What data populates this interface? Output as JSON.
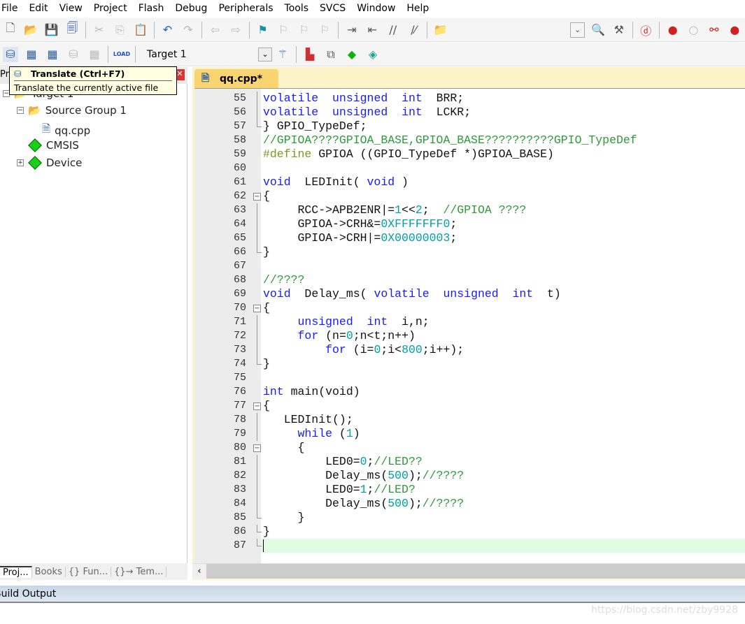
{
  "menu": [
    "File",
    "Edit",
    "View",
    "Project",
    "Flash",
    "Debug",
    "Peripherals",
    "Tools",
    "SVCS",
    "Window",
    "Help"
  ],
  "toolbar2": {
    "target": "Target 1",
    "load_label": "LOAD"
  },
  "tooltip": {
    "title": "Translate (Ctrl+F7)",
    "description": "Translate the currently active file"
  },
  "project": {
    "header": "Proj",
    "tree": [
      {
        "label": "Target 1",
        "level": 0,
        "toggle": "-",
        "icon": "folder-target-icon"
      },
      {
        "label": "Source Group 1",
        "level": 1,
        "toggle": "-",
        "icon": "folder-open-icon"
      },
      {
        "label": "qq.cpp",
        "level": 2,
        "toggle": "",
        "icon": "cpp-file-icon"
      },
      {
        "label": "CMSIS",
        "level": 1,
        "toggle": "",
        "icon": "component-diamond-icon"
      },
      {
        "label": "Device",
        "level": 1,
        "toggle": "+",
        "icon": "component-diamond-icon"
      }
    ],
    "tabs": [
      "Proj...",
      "Books",
      "{} Fun...",
      "{}→ Tem..."
    ]
  },
  "editor": {
    "tab": "qq.cpp*",
    "current_line": 87,
    "lines": [
      {
        "n": 55,
        "f": "v",
        "t": [
          [
            "kw",
            "volatile"
          ],
          [
            "tx",
            "  "
          ],
          [
            "kw",
            "unsigned"
          ],
          [
            "tx",
            "  "
          ],
          [
            "kw",
            "int"
          ],
          [
            "tx",
            "  BRR;"
          ]
        ]
      },
      {
        "n": 56,
        "f": "v",
        "t": [
          [
            "kw",
            "volatile"
          ],
          [
            "tx",
            "  "
          ],
          [
            "kw",
            "unsigned"
          ],
          [
            "tx",
            "  "
          ],
          [
            "kw",
            "int"
          ],
          [
            "tx",
            "  LCKR;"
          ]
        ]
      },
      {
        "n": 57,
        "f": "e",
        "t": [
          [
            "tx",
            "} GPIO_TypeDef;"
          ]
        ]
      },
      {
        "n": 58,
        "f": "",
        "t": [
          [
            "cm",
            "//GPIOA????GPIOA_BASE,GPIOA_BASE??????????GPIO_TypeDef"
          ]
        ]
      },
      {
        "n": 59,
        "f": "",
        "t": [
          [
            "pp",
            "#define"
          ],
          [
            "tx",
            " GPIOA ((GPIO_TypeDef *)GPIOA_BASE)"
          ]
        ]
      },
      {
        "n": 60,
        "f": "",
        "t": []
      },
      {
        "n": 61,
        "f": "",
        "t": [
          [
            "kw",
            "void"
          ],
          [
            "tx",
            "  LEDInit( "
          ],
          [
            "kw",
            "void"
          ],
          [
            "tx",
            " )"
          ]
        ]
      },
      {
        "n": 62,
        "f": "b",
        "t": [
          [
            "tx",
            "{"
          ]
        ]
      },
      {
        "n": 63,
        "f": "v",
        "t": [
          [
            "tx",
            "     RCC->APB2ENR|="
          ],
          [
            "num",
            "1"
          ],
          [
            "tx",
            "<<"
          ],
          [
            "num",
            "2"
          ],
          [
            "tx",
            ";  "
          ],
          [
            "cm",
            "//GPIOA ????"
          ]
        ]
      },
      {
        "n": 64,
        "f": "v",
        "t": [
          [
            "tx",
            "     GPIOA->CRH&="
          ],
          [
            "num",
            "0XFFFFFFF0"
          ],
          [
            "tx",
            ";"
          ]
        ]
      },
      {
        "n": 65,
        "f": "v",
        "t": [
          [
            "tx",
            "     GPIOA->CRH|="
          ],
          [
            "num",
            "0X00000003"
          ],
          [
            "tx",
            ";"
          ]
        ]
      },
      {
        "n": 66,
        "f": "e",
        "t": [
          [
            "tx",
            "}"
          ]
        ]
      },
      {
        "n": 67,
        "f": "",
        "t": []
      },
      {
        "n": 68,
        "f": "",
        "t": [
          [
            "cm",
            "//????"
          ]
        ]
      },
      {
        "n": 69,
        "f": "",
        "t": [
          [
            "kw",
            "void"
          ],
          [
            "tx",
            "  Delay_ms( "
          ],
          [
            "kw",
            "volatile"
          ],
          [
            "tx",
            "  "
          ],
          [
            "kw",
            "unsigned"
          ],
          [
            "tx",
            "  "
          ],
          [
            "kw",
            "int"
          ],
          [
            "tx",
            "  t)"
          ]
        ]
      },
      {
        "n": 70,
        "f": "b",
        "t": [
          [
            "tx",
            "{"
          ]
        ]
      },
      {
        "n": 71,
        "f": "v",
        "t": [
          [
            "tx",
            "     "
          ],
          [
            "kw",
            "unsigned"
          ],
          [
            "tx",
            "  "
          ],
          [
            "kw",
            "int"
          ],
          [
            "tx",
            "  i,n;"
          ]
        ]
      },
      {
        "n": 72,
        "f": "v",
        "t": [
          [
            "tx",
            "     "
          ],
          [
            "kw",
            "for"
          ],
          [
            "tx",
            " (n="
          ],
          [
            "num",
            "0"
          ],
          [
            "tx",
            ";n<t;n++)"
          ]
        ]
      },
      {
        "n": 73,
        "f": "v",
        "t": [
          [
            "tx",
            "         "
          ],
          [
            "kw",
            "for"
          ],
          [
            "tx",
            " (i="
          ],
          [
            "num",
            "0"
          ],
          [
            "tx",
            ";i<"
          ],
          [
            "num",
            "800"
          ],
          [
            "tx",
            ";i++);"
          ]
        ]
      },
      {
        "n": 74,
        "f": "e",
        "t": [
          [
            "tx",
            "}"
          ]
        ]
      },
      {
        "n": 75,
        "f": "",
        "t": []
      },
      {
        "n": 76,
        "f": "",
        "t": [
          [
            "kw",
            "int"
          ],
          [
            "tx",
            " main(void)"
          ]
        ]
      },
      {
        "n": 77,
        "f": "b",
        "t": [
          [
            "tx",
            "{"
          ]
        ]
      },
      {
        "n": 78,
        "f": "v",
        "t": [
          [
            "tx",
            "   LEDInit();"
          ]
        ]
      },
      {
        "n": 79,
        "f": "v",
        "t": [
          [
            "tx",
            "     "
          ],
          [
            "kw",
            "while"
          ],
          [
            "tx",
            " ("
          ],
          [
            "num",
            "1"
          ],
          [
            "tx",
            ")"
          ]
        ]
      },
      {
        "n": 80,
        "f": "b",
        "t": [
          [
            "tx",
            "     {"
          ]
        ]
      },
      {
        "n": 81,
        "f": "v",
        "t": [
          [
            "tx",
            "         LED0="
          ],
          [
            "num",
            "0"
          ],
          [
            "tx",
            ";"
          ],
          [
            "cm",
            "//LED??"
          ]
        ]
      },
      {
        "n": 82,
        "f": "v",
        "t": [
          [
            "tx",
            "         Delay_ms("
          ],
          [
            "num",
            "500"
          ],
          [
            "tx",
            ");"
          ],
          [
            "cm",
            "//????"
          ]
        ]
      },
      {
        "n": 83,
        "f": "v",
        "t": [
          [
            "tx",
            "         LED0="
          ],
          [
            "num",
            "1"
          ],
          [
            "tx",
            ";"
          ],
          [
            "cm",
            "//LED?"
          ]
        ]
      },
      {
        "n": 84,
        "f": "v",
        "t": [
          [
            "tx",
            "         Delay_ms("
          ],
          [
            "num",
            "500"
          ],
          [
            "tx",
            ");"
          ],
          [
            "cm",
            "//????"
          ]
        ]
      },
      {
        "n": 85,
        "f": "e",
        "t": [
          [
            "tx",
            "     }"
          ]
        ]
      },
      {
        "n": 86,
        "f": "e",
        "t": [
          [
            "tx",
            "}"
          ]
        ]
      },
      {
        "n": 87,
        "f": "e",
        "t": []
      }
    ]
  },
  "build_output": "Build Output",
  "watermark": "https://blog.csdn.net/zby9928",
  "colors": {
    "keyword": "#1a1aff",
    "comment": "#2e9a3a",
    "number": "#00a0a8",
    "preprocessor": "#7a9a20",
    "current_line": "#e0fde4",
    "tab": "#fad470"
  }
}
